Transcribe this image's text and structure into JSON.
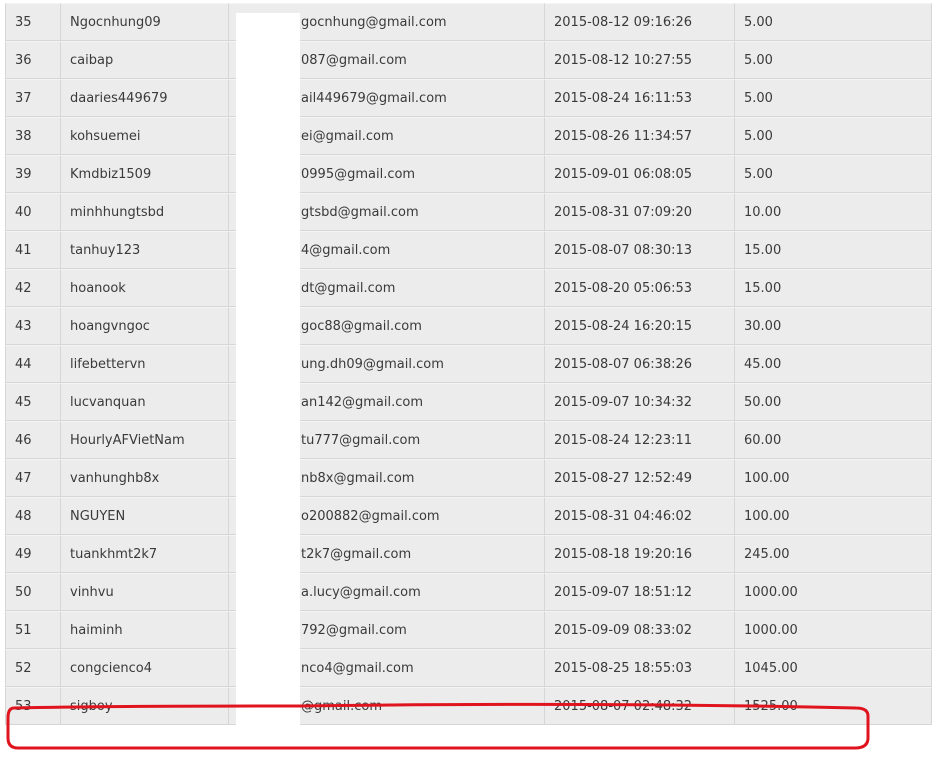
{
  "leaderboard": {
    "rows": [
      {
        "rank": "35",
        "username": "Ngocnhung09",
        "email": "gocnhung@gmail.com",
        "date": "2015-08-12 09:16:26",
        "amount": "5.00"
      },
      {
        "rank": "36",
        "username": "caibap",
        "email": "087@gmail.com",
        "date": "2015-08-12 10:27:55",
        "amount": "5.00"
      },
      {
        "rank": "37",
        "username": "daaries449679",
        "email": "ail449679@gmail.com",
        "date": "2015-08-24 16:11:53",
        "amount": "5.00"
      },
      {
        "rank": "38",
        "username": "kohsuemei",
        "email": "ei@gmail.com",
        "date": "2015-08-26 11:34:57",
        "amount": "5.00"
      },
      {
        "rank": "39",
        "username": "Kmdbiz1509",
        "email": "0995@gmail.com",
        "date": "2015-09-01 06:08:05",
        "amount": "5.00"
      },
      {
        "rank": "40",
        "username": "minhhungtsbd",
        "email": "gtsbd@gmail.com",
        "date": "2015-08-31 07:09:20",
        "amount": "10.00"
      },
      {
        "rank": "41",
        "username": "tanhuy123",
        "email": "4@gmail.com",
        "date": "2015-08-07 08:30:13",
        "amount": "15.00"
      },
      {
        "rank": "42",
        "username": "hoanook",
        "email": "dt@gmail.com",
        "date": "2015-08-20 05:06:53",
        "amount": "15.00"
      },
      {
        "rank": "43",
        "username": "hoangvngoc",
        "email": "goc88@gmail.com",
        "date": "2015-08-24 16:20:15",
        "amount": "30.00"
      },
      {
        "rank": "44",
        "username": "lifebettervn",
        "email": "ung.dh09@gmail.com",
        "date": "2015-08-07 06:38:26",
        "amount": "45.00"
      },
      {
        "rank": "45",
        "username": "lucvanquan",
        "email": "an142@gmail.com",
        "date": "2015-09-07 10:34:32",
        "amount": "50.00"
      },
      {
        "rank": "46",
        "username": "HourlyAFVietNam",
        "email": "tu777@gmail.com",
        "date": "2015-08-24 12:23:11",
        "amount": "60.00"
      },
      {
        "rank": "47",
        "username": "vanhunghb8x",
        "email": "nb8x@gmail.com",
        "date": "2015-08-27 12:52:49",
        "amount": "100.00"
      },
      {
        "rank": "48",
        "username": "NGUYEN",
        "email": "o200882@gmail.com",
        "date": "2015-08-31 04:46:02",
        "amount": "100.00"
      },
      {
        "rank": "49",
        "username": "tuankhmt2k7",
        "email": "t2k7@gmail.com",
        "date": "2015-08-18 19:20:16",
        "amount": "245.00"
      },
      {
        "rank": "50",
        "username": "vinhvu",
        "email": "a.lucy@gmail.com",
        "date": "2015-09-07 18:51:12",
        "amount": "1000.00"
      },
      {
        "rank": "51",
        "username": "haiminh",
        "email": "792@gmail.com",
        "date": "2015-09-09 08:33:02",
        "amount": "1000.00"
      },
      {
        "rank": "52",
        "username": "congcienco4",
        "email": "nco4@gmail.com",
        "date": "2015-08-25 18:55:03",
        "amount": "1045.00"
      },
      {
        "rank": "53",
        "username": "sigboy",
        "email": "@gmail.com",
        "date": "2015-08-07 02:48:32",
        "amount": "1525.00"
      }
    ]
  },
  "colors": {
    "row_background": "#ececec",
    "cell_border": "#d6d6d6",
    "text": "#3a3a3a",
    "highlight": "#e0141e",
    "redaction": "#ffffff"
  }
}
